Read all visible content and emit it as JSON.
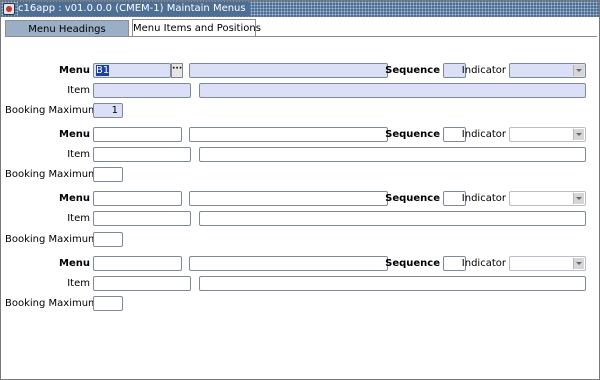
{
  "window": {
    "title": "c16app : v01.0.0.0 (CMEM-1) Maintain Menus"
  },
  "tabs": [
    {
      "label": "Menu Headings"
    },
    {
      "label": "Menu Items and Positions"
    }
  ],
  "labels": {
    "menu": "Menu",
    "sequence": "Sequence",
    "indicator": "Indicator",
    "item": "Item",
    "booking_maximum": "Booking Maximum"
  },
  "records": [
    {
      "menu_code": "B1",
      "menu_desc": "",
      "sequence": "",
      "indicator": "",
      "item_code": "",
      "item_desc": "",
      "booking_maximum": "1"
    },
    {
      "menu_code": "",
      "menu_desc": "",
      "sequence": "",
      "indicator": "",
      "item_code": "",
      "item_desc": "",
      "booking_maximum": ""
    },
    {
      "menu_code": "",
      "menu_desc": "",
      "sequence": "",
      "indicator": "",
      "item_code": "",
      "item_desc": "",
      "booking_maximum": ""
    },
    {
      "menu_code": "",
      "menu_desc": "",
      "sequence": "",
      "indicator": "",
      "item_code": "",
      "item_desc": "",
      "booking_maximum": ""
    }
  ],
  "colors": {
    "titlebar": "#4d6f96",
    "active_field": "#dbe0f6",
    "selection": "#1c3fa6",
    "inactive_tab": "#9aaec5"
  }
}
